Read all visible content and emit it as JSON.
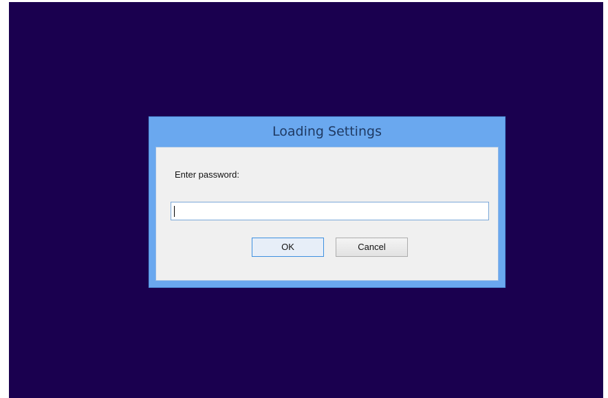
{
  "dialog": {
    "title": "Loading Settings",
    "prompt": "Enter password:",
    "password": {
      "value": "",
      "placeholder": ""
    },
    "buttons": {
      "ok": "OK",
      "cancel": "Cancel"
    }
  },
  "colors": {
    "desktop_background": "#1a004f",
    "dialog_frame": "#6aa8ef",
    "dialog_body": "#f0f0f0",
    "focus_border": "#3c8fe0"
  }
}
